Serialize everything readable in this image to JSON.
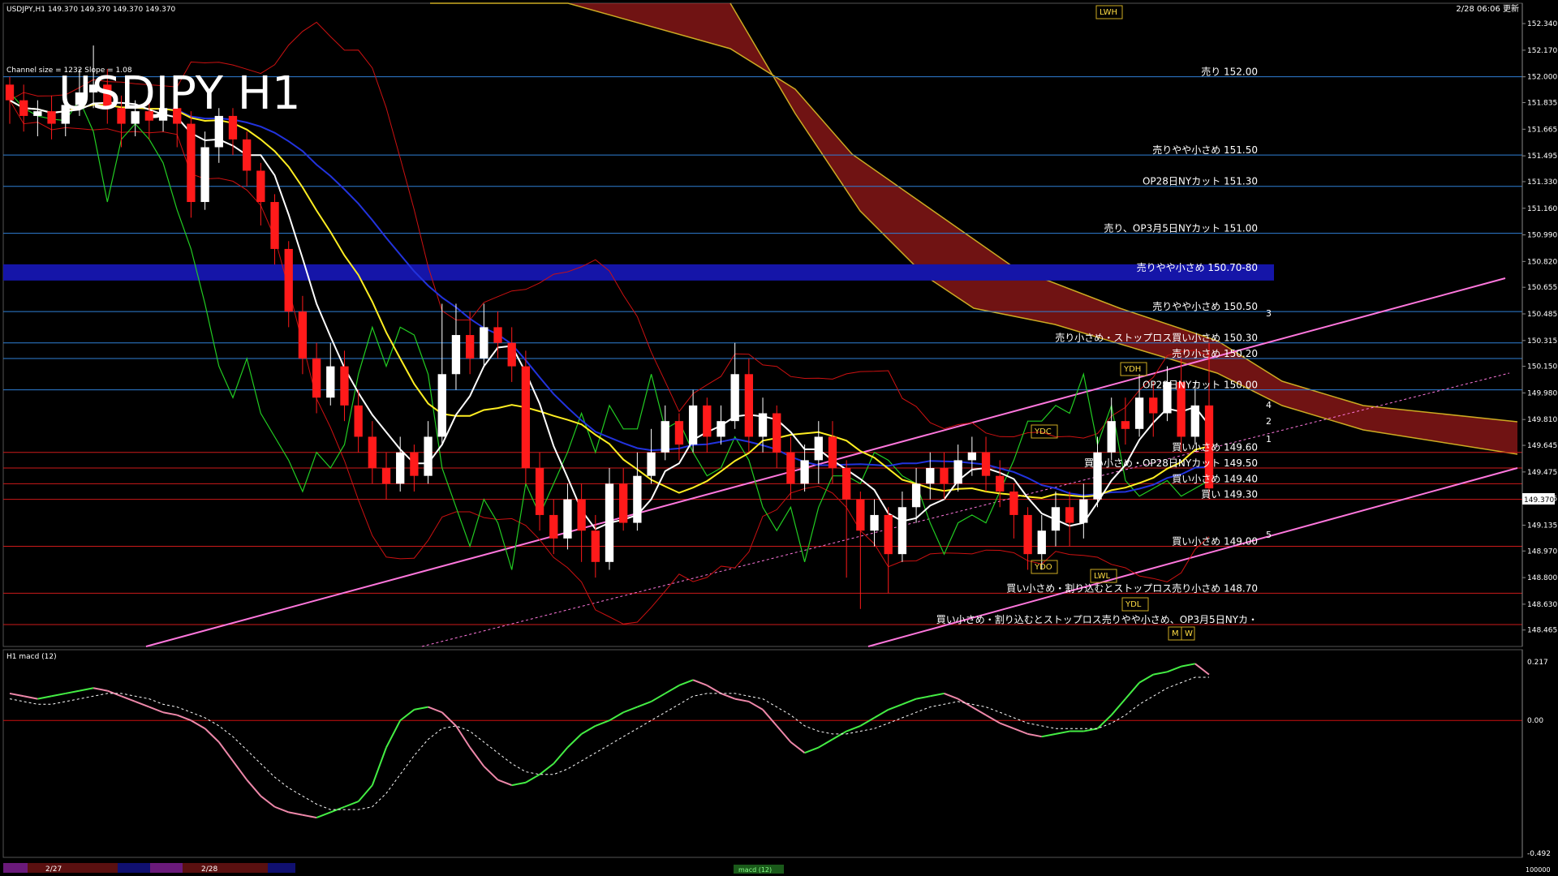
{
  "window": {
    "header": "USDJPY,H1  149.370 149.370 149.370 149.370",
    "update_time": "2/28 06:06 更新",
    "channel_info": "Channel size = 1232 Slope = 1.08",
    "big_title": "USDJPY H1",
    "macd_label": "H1  macd (12)",
    "timeline_labels": [
      "2/27",
      "2/28"
    ],
    "bottom_tab": "macd (12)",
    "bottom_right_value": "100000"
  },
  "chart_data": {
    "type": "candlestick",
    "title": "USDJPY H1",
    "price_axis": {
      "ylim": [
        148.36,
        152.47
      ],
      "ticks": [
        152.34,
        152.17,
        152.0,
        151.835,
        151.665,
        151.495,
        151.33,
        151.16,
        150.99,
        150.82,
        150.655,
        150.485,
        150.315,
        150.15,
        149.98,
        149.81,
        149.645,
        149.475,
        149.305,
        149.135,
        148.97,
        148.8,
        148.63,
        148.465
      ],
      "tick_labels": [
        "152.340",
        "152.170",
        "152.000",
        "151.835",
        "151.665",
        "151.495",
        "151.330",
        "151.160",
        "150.990",
        "150.820",
        "150.655",
        "150.485",
        "150.315",
        "150.150",
        "149.980",
        "149.810",
        "149.645",
        "149.475",
        "149.305",
        "149.135",
        "148.970",
        "148.800",
        "148.630",
        "148.465"
      ],
      "current_price": 149.37,
      "current_label": "149.370"
    },
    "levels": [
      {
        "price": 152.0,
        "label": "売り 152.00",
        "color": "#2f7fd6"
      },
      {
        "price": 151.5,
        "label": "売りやや小さめ 151.50",
        "color": "#2f7fd6"
      },
      {
        "price": 151.3,
        "label": "OP28日NYカット 151.30",
        "color": "#2f7fd6"
      },
      {
        "price": 151.0,
        "label": "売り、OP3月5日NYカット 151.00",
        "color": "#2f7fd6"
      },
      {
        "price": 150.75,
        "label": "売りやや小さめ 150.70-80",
        "color": "#1515a8",
        "band": true
      },
      {
        "price": 150.5,
        "label": "売りやや小さめ 150.50",
        "color": "#2f7fd6"
      },
      {
        "price": 150.3,
        "label": "売り小さめ・ストップロス買い小さめ 150.30",
        "color": "#2f7fd6"
      },
      {
        "price": 150.2,
        "label": "売り小さめ 150.20",
        "color": "#2f7fd6"
      },
      {
        "price": 150.0,
        "label": "OP28日NYカット 150.00",
        "color": "#2f7fd6"
      },
      {
        "price": 149.6,
        "label": "買い小さめ 149.60",
        "color": "#cc1a1a"
      },
      {
        "price": 149.5,
        "label": "買い小さめ・OP28日NYカット 149.50",
        "color": "#cc1a1a"
      },
      {
        "price": 149.4,
        "label": "買い小さめ 149.40",
        "color": "#cc1a1a"
      },
      {
        "price": 149.3,
        "label": "買い 149.30",
        "color": "#cc1a1a"
      },
      {
        "price": 149.0,
        "label": "買い小さめ 149.00",
        "color": "#cc1a1a"
      },
      {
        "price": 148.7,
        "label": "買い小さめ・割り込むとストップロス売り小さめ 148.70",
        "color": "#cc1a1a"
      },
      {
        "price": 148.5,
        "label": "買い小さめ・割り込むとストップロス売りやや小さめ、OP3月5日NYカ・",
        "color": "#cc1a1a"
      }
    ],
    "markers": [
      "YDH",
      "YDC",
      "YDO",
      "YDL",
      "LWH",
      "LWL",
      "M",
      "W",
      "1",
      "2",
      "3",
      "4",
      "5"
    ],
    "candles": [
      [
        151.95,
        151.85,
        151.7,
        152.0
      ],
      [
        151.85,
        151.75,
        151.65,
        151.95
      ],
      [
        151.75,
        151.78,
        151.62,
        151.85
      ],
      [
        151.78,
        151.7,
        151.6,
        151.88
      ],
      [
        151.7,
        151.82,
        151.62,
        151.95
      ],
      [
        151.82,
        151.9,
        151.75,
        152.05
      ],
      [
        151.9,
        151.95,
        151.8,
        152.2
      ],
      [
        151.95,
        151.8,
        151.7,
        152.05
      ],
      [
        151.8,
        151.7,
        151.55,
        151.88
      ],
      [
        151.7,
        151.78,
        151.62,
        151.85
      ],
      [
        151.78,
        151.72,
        151.6,
        151.85
      ],
      [
        151.72,
        151.8,
        151.65,
        151.9
      ],
      [
        151.8,
        151.7,
        151.55,
        151.85
      ],
      [
        151.7,
        151.2,
        151.1,
        151.78
      ],
      [
        151.2,
        151.55,
        151.15,
        151.65
      ],
      [
        151.55,
        151.75,
        151.45,
        151.8
      ],
      [
        151.75,
        151.6,
        151.5,
        151.8
      ],
      [
        151.6,
        151.4,
        151.3,
        151.65
      ],
      [
        151.4,
        151.2,
        151.05,
        151.45
      ],
      [
        151.2,
        150.9,
        150.8,
        151.25
      ],
      [
        150.9,
        150.5,
        150.4,
        150.95
      ],
      [
        150.5,
        150.2,
        150.1,
        150.6
      ],
      [
        150.2,
        149.95,
        149.85,
        150.3
      ],
      [
        149.95,
        150.15,
        149.9,
        150.3
      ],
      [
        150.15,
        149.9,
        149.8,
        150.25
      ],
      [
        149.9,
        149.7,
        149.6,
        150.0
      ],
      [
        149.7,
        149.5,
        149.4,
        149.8
      ],
      [
        149.5,
        149.4,
        149.3,
        149.6
      ],
      [
        149.4,
        149.6,
        149.35,
        149.7
      ],
      [
        149.6,
        149.45,
        149.35,
        149.65
      ],
      [
        149.45,
        149.7,
        149.4,
        149.8
      ],
      [
        149.7,
        150.1,
        149.65,
        150.55
      ],
      [
        150.1,
        150.35,
        150.0,
        150.55
      ],
      [
        150.35,
        150.2,
        150.1,
        150.5
      ],
      [
        150.2,
        150.4,
        150.15,
        150.55
      ],
      [
        150.4,
        150.3,
        150.2,
        150.5
      ],
      [
        150.3,
        150.15,
        150.05,
        150.4
      ],
      [
        150.15,
        149.5,
        149.4,
        150.25
      ],
      [
        149.5,
        149.2,
        149.1,
        149.6
      ],
      [
        149.2,
        149.05,
        148.95,
        149.3
      ],
      [
        149.05,
        149.3,
        148.98,
        149.4
      ],
      [
        149.3,
        149.1,
        148.9,
        149.4
      ],
      [
        149.1,
        148.9,
        148.8,
        149.2
      ],
      [
        148.9,
        149.4,
        148.85,
        149.5
      ],
      [
        149.4,
        149.15,
        149.1,
        149.5
      ],
      [
        149.15,
        149.45,
        149.1,
        149.6
      ],
      [
        149.45,
        149.6,
        149.4,
        149.75
      ],
      [
        149.6,
        149.8,
        149.55,
        149.9
      ],
      [
        149.8,
        149.65,
        149.55,
        149.85
      ],
      [
        149.65,
        149.9,
        149.6,
        150.0
      ],
      [
        149.9,
        149.7,
        149.6,
        149.95
      ],
      [
        149.7,
        149.8,
        149.65,
        149.9
      ],
      [
        149.8,
        150.1,
        149.75,
        150.3
      ],
      [
        150.1,
        149.7,
        149.6,
        150.2
      ],
      [
        149.7,
        149.85,
        149.6,
        149.95
      ],
      [
        149.85,
        149.6,
        149.5,
        149.9
      ],
      [
        149.6,
        149.4,
        149.3,
        149.7
      ],
      [
        149.4,
        149.55,
        149.35,
        149.65
      ],
      [
        149.55,
        149.7,
        149.4,
        149.8
      ],
      [
        149.7,
        149.5,
        149.4,
        149.8
      ],
      [
        149.5,
        149.3,
        148.8,
        149.55
      ],
      [
        149.3,
        149.1,
        148.6,
        149.35
      ],
      [
        149.1,
        149.2,
        149.0,
        149.3
      ],
      [
        149.2,
        148.95,
        148.7,
        149.25
      ],
      [
        148.95,
        149.25,
        148.9,
        149.35
      ],
      [
        149.25,
        149.4,
        149.15,
        149.5
      ],
      [
        149.4,
        149.5,
        149.3,
        149.6
      ],
      [
        149.5,
        149.4,
        149.3,
        149.6
      ],
      [
        149.4,
        149.55,
        149.35,
        149.65
      ],
      [
        149.55,
        149.6,
        149.45,
        149.7
      ],
      [
        149.6,
        149.45,
        149.35,
        149.7
      ],
      [
        149.45,
        149.35,
        149.25,
        149.55
      ],
      [
        149.35,
        149.2,
        149.05,
        149.4
      ],
      [
        149.2,
        148.95,
        148.85,
        149.25
      ],
      [
        148.95,
        149.1,
        148.85,
        149.2
      ],
      [
        149.1,
        149.25,
        149.0,
        149.35
      ],
      [
        149.25,
        149.15,
        149.0,
        149.35
      ],
      [
        149.15,
        149.3,
        149.05,
        149.4
      ],
      [
        149.3,
        149.6,
        149.25,
        149.7
      ],
      [
        149.6,
        149.8,
        149.55,
        149.95
      ],
      [
        149.8,
        149.75,
        149.65,
        149.95
      ],
      [
        149.75,
        149.95,
        149.7,
        150.1
      ],
      [
        149.95,
        149.85,
        149.7,
        150.05
      ],
      [
        149.85,
        150.05,
        149.8,
        150.15
      ],
      [
        150.05,
        149.7,
        149.6,
        150.2
      ],
      [
        149.7,
        149.9,
        149.65,
        150.05
      ],
      [
        149.9,
        149.37,
        149.3,
        150.3
      ]
    ],
    "macd_axis": {
      "ylim": [
        -0.492,
        0.217
      ],
      "tick_labels": [
        "0.217",
        "0.00",
        "-0.492"
      ]
    },
    "macd_main": [
      0.1,
      0.09,
      0.08,
      0.09,
      0.1,
      0.11,
      0.12,
      0.11,
      0.09,
      0.07,
      0.05,
      0.03,
      0.02,
      0.0,
      -0.03,
      -0.08,
      -0.15,
      -0.22,
      -0.28,
      -0.32,
      -0.34,
      -0.35,
      -0.36,
      -0.34,
      -0.32,
      -0.3,
      -0.24,
      -0.1,
      0.0,
      0.04,
      0.05,
      0.03,
      -0.02,
      -0.1,
      -0.17,
      -0.22,
      -0.24,
      -0.23,
      -0.2,
      -0.16,
      -0.1,
      -0.05,
      -0.02,
      0.0,
      0.03,
      0.05,
      0.07,
      0.1,
      0.13,
      0.15,
      0.13,
      0.1,
      0.08,
      0.07,
      0.04,
      -0.02,
      -0.08,
      -0.12,
      -0.1,
      -0.07,
      -0.04,
      -0.02,
      0.01,
      0.04,
      0.06,
      0.08,
      0.09,
      0.1,
      0.08,
      0.05,
      0.02,
      -0.01,
      -0.03,
      -0.05,
      -0.06,
      -0.05,
      -0.04,
      -0.04,
      -0.03,
      0.02,
      0.08,
      0.14,
      0.17,
      0.18,
      0.2,
      0.21,
      0.17
    ],
    "macd_signal": [
      0.08,
      0.07,
      0.06,
      0.06,
      0.07,
      0.08,
      0.09,
      0.1,
      0.1,
      0.09,
      0.08,
      0.06,
      0.05,
      0.03,
      0.01,
      -0.02,
      -0.06,
      -0.11,
      -0.16,
      -0.21,
      -0.25,
      -0.28,
      -0.31,
      -0.33,
      -0.33,
      -0.33,
      -0.32,
      -0.27,
      -0.2,
      -0.13,
      -0.07,
      -0.03,
      -0.02,
      -0.04,
      -0.08,
      -0.12,
      -0.16,
      -0.19,
      -0.2,
      -0.2,
      -0.18,
      -0.15,
      -0.12,
      -0.09,
      -0.06,
      -0.03,
      0.0,
      0.03,
      0.06,
      0.09,
      0.1,
      0.1,
      0.1,
      0.09,
      0.08,
      0.05,
      0.02,
      -0.02,
      -0.04,
      -0.05,
      -0.05,
      -0.04,
      -0.03,
      -0.01,
      0.01,
      0.03,
      0.05,
      0.06,
      0.07,
      0.06,
      0.05,
      0.03,
      0.01,
      -0.01,
      -0.02,
      -0.03,
      -0.03,
      -0.03,
      -0.03,
      -0.01,
      0.02,
      0.06,
      0.09,
      0.12,
      0.14,
      0.16,
      0.16
    ]
  },
  "colors": {
    "background": "#000000",
    "candle_up": "#ffffff",
    "candle_down": "#ff1a1a",
    "ma_white": "#ffffff",
    "ma_yellow": "#ffee22",
    "ma_blue": "#2233dd",
    "bollinger": "#cc1111",
    "chikou_green": "#22cc22",
    "cloud_red": "#cc2222",
    "cloud_line": "#ccaa22",
    "channel": "#ff77dd",
    "macd_up": "#44ee44",
    "macd_down": "#ee88aa",
    "axis_text": "#ffffff"
  }
}
